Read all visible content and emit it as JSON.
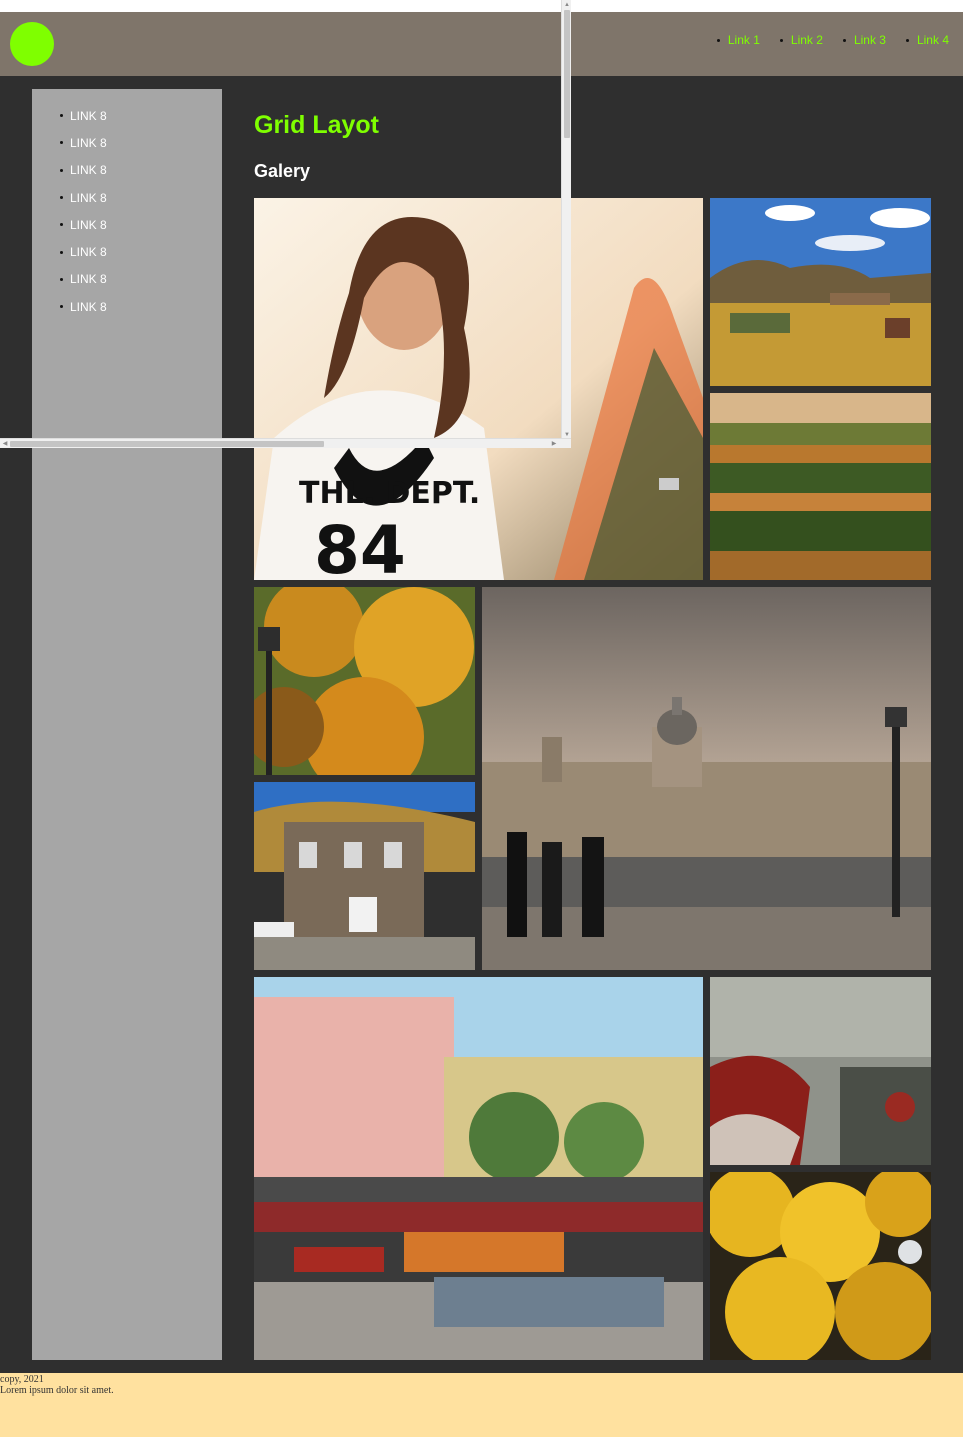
{
  "header": {
    "nav": [
      {
        "label": "Link 1"
      },
      {
        "label": "Link 2"
      },
      {
        "label": "Link 3"
      },
      {
        "label": "Link 4"
      }
    ]
  },
  "sidebar": {
    "items": [
      {
        "label": "LINK 8"
      },
      {
        "label": "LINK 8"
      },
      {
        "label": "LINK 8"
      },
      {
        "label": "LINK 8"
      },
      {
        "label": "LINK 8"
      },
      {
        "label": "LINK 8"
      },
      {
        "label": "LINK 8"
      },
      {
        "label": "LINK 8"
      }
    ]
  },
  "main": {
    "title": "Grid Layot",
    "subtitle": "Galery"
  },
  "gallery": {
    "photos": [
      {
        "icon": "woman-smiling-photo"
      },
      {
        "icon": "mountain-town-photo"
      },
      {
        "icon": "autumn-leaves-steps-photo"
      },
      {
        "icon": "autumn-tree-photo"
      },
      {
        "icon": "wooden-house-photo"
      },
      {
        "icon": "paris-bridge-photo"
      },
      {
        "icon": "market-square-photo"
      },
      {
        "icon": "rainy-window-photo"
      },
      {
        "icon": "yellow-maple-photo"
      }
    ]
  },
  "footer": {
    "copyright": "copy, 2021",
    "text": "Lorem ipsum dolor sit amet."
  },
  "colors": {
    "accent": "#7fff00",
    "header_bg": "#7f756a",
    "main_bg": "#2f2f2f",
    "sidebar_bg": "#a6a6a6",
    "footer_bg": "#ffe19f"
  }
}
